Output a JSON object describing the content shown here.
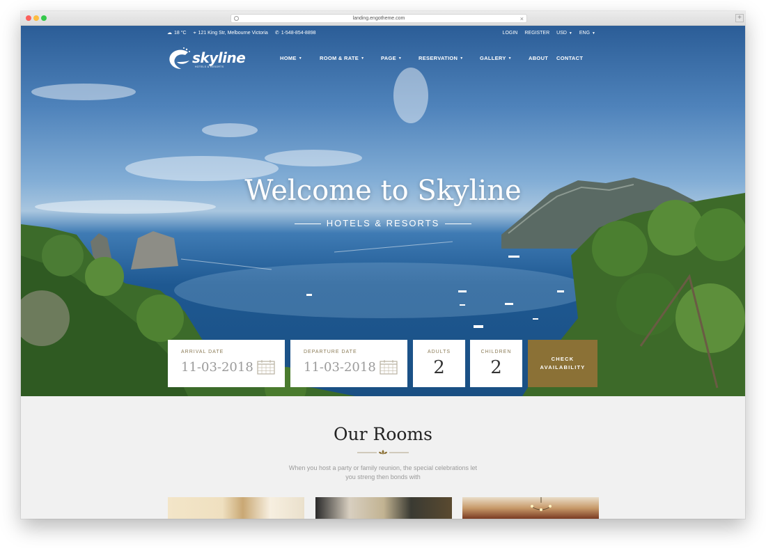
{
  "browser": {
    "url": "landing.engotheme.com"
  },
  "topbar": {
    "weather": "18 °C",
    "address": "121 King Str, Melbourne Victoria",
    "phone": "1-548-854-8898",
    "login": "LOGIN",
    "register": "REGISTER",
    "currency": "USD",
    "language": "ENG"
  },
  "brand": {
    "name": "skyline",
    "tagline": "HOTELS & RESORTS"
  },
  "nav": {
    "home": "HOME",
    "room_rate": "ROOM & RATE",
    "page": "PAGE",
    "reservation": "RESERVATION",
    "gallery": "GALLERY",
    "about": "ABOUT",
    "contact": "CONTACT"
  },
  "hero": {
    "title": "Welcome to Skyline",
    "subtitle": "HOTELS & RESORTS"
  },
  "booking": {
    "arrival_label": "ARRIVAL DATE",
    "arrival_value": "11-03-2018",
    "departure_label": "DEPARTURE DATE",
    "departure_value": "11-03-2018",
    "adults_label": "ADULTS",
    "adults_value": "2",
    "children_label": "CHILDREN",
    "children_value": "2",
    "check_line1": "CHECK",
    "check_line2": "AVAILABILITY"
  },
  "rooms": {
    "heading": "Our Rooms",
    "desc_line1": "When you host a party or family reunion, the special celebrations let",
    "desc_line2": "you streng then bonds with"
  },
  "colors": {
    "accent": "#8b7136",
    "label": "#8a7a55"
  }
}
